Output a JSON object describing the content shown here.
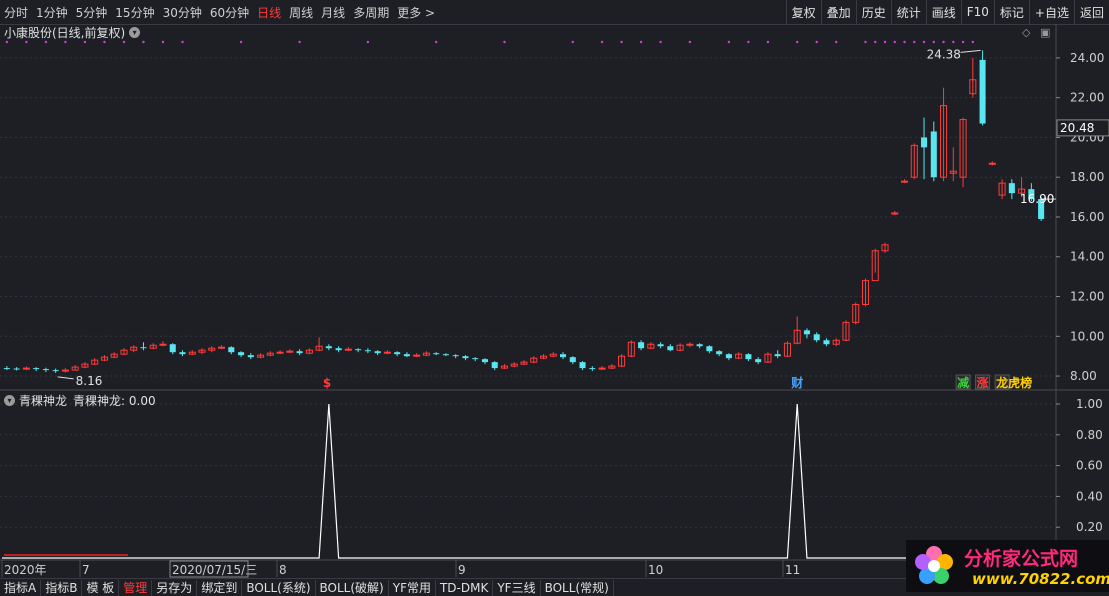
{
  "toolbar": {
    "periods": [
      "分时",
      "1分钟",
      "5分钟",
      "15分钟",
      "30分钟",
      "60分钟",
      "日线",
      "周线",
      "月线",
      "多周期",
      "更多 >"
    ],
    "active_period": "日线",
    "actions": [
      "复权",
      "叠加",
      "历史",
      "统计",
      "画线",
      "F10",
      "标记",
      "+自选",
      "返回"
    ]
  },
  "chart": {
    "title": "小康股份(日线,前复权)",
    "price_axis": [
      "24.00",
      "22.00",
      "20.00",
      "18.00",
      "16.00",
      "14.00",
      "12.00",
      "10.00",
      "8.00"
    ],
    "current_price_box": "20.48",
    "last_price_box": "16.90",
    "max_annotation": "24.38",
    "min_annotation": "8.16",
    "event_markers": [
      {
        "label": "$",
        "color": "#ff3b3b"
      },
      {
        "label": "财",
        "color": "#4aa3ff"
      },
      {
        "label": "减",
        "color": "#3ecf3e"
      },
      {
        "label": "涨",
        "color": "#ff3b3b"
      },
      {
        "label": "龙虎榜",
        "color": "#ffd000"
      }
    ]
  },
  "chart_data": {
    "type": "candlestick",
    "title": "小康股份(日线,前复权)",
    "ylim": [
      7.5,
      24.9
    ],
    "candles": [
      [
        8.4,
        8.38,
        8.5,
        8.3
      ],
      [
        8.38,
        8.36,
        8.45,
        8.28
      ],
      [
        8.36,
        8.4,
        8.48,
        8.3
      ],
      [
        8.4,
        8.35,
        8.45,
        8.25
      ],
      [
        8.35,
        8.3,
        8.42,
        8.2
      ],
      [
        8.3,
        8.25,
        8.38,
        8.16
      ],
      [
        8.25,
        8.3,
        8.4,
        8.18
      ],
      [
        8.3,
        8.45,
        8.55,
        8.28
      ],
      [
        8.45,
        8.6,
        8.7,
        8.4
      ],
      [
        8.6,
        8.8,
        8.9,
        8.55
      ],
      [
        8.8,
        8.95,
        9.05,
        8.75
      ],
      [
        8.95,
        9.1,
        9.2,
        8.9
      ],
      [
        9.1,
        9.3,
        9.4,
        9.05
      ],
      [
        9.3,
        9.45,
        9.55,
        9.2
      ],
      [
        9.45,
        9.4,
        9.7,
        9.3
      ],
      [
        9.4,
        9.55,
        9.65,
        9.35
      ],
      [
        9.55,
        9.6,
        9.75,
        9.5
      ],
      [
        9.6,
        9.2,
        9.65,
        9.1
      ],
      [
        9.2,
        9.1,
        9.3,
        9.0
      ],
      [
        9.1,
        9.2,
        9.3,
        9.05
      ],
      [
        9.2,
        9.3,
        9.4,
        9.1
      ],
      [
        9.3,
        9.4,
        9.5,
        9.2
      ],
      [
        9.4,
        9.45,
        9.55,
        9.35
      ],
      [
        9.45,
        9.2,
        9.5,
        9.1
      ],
      [
        9.2,
        9.05,
        9.25,
        8.95
      ],
      [
        9.05,
        8.95,
        9.15,
        8.85
      ],
      [
        8.95,
        9.05,
        9.15,
        8.9
      ],
      [
        9.05,
        9.15,
        9.25,
        9.0
      ],
      [
        9.15,
        9.2,
        9.3,
        9.1
      ],
      [
        9.2,
        9.25,
        9.35,
        9.15
      ],
      [
        9.25,
        9.15,
        9.35,
        9.05
      ],
      [
        9.15,
        9.3,
        9.4,
        9.1
      ],
      [
        9.3,
        9.5,
        9.95,
        9.25
      ],
      [
        9.5,
        9.4,
        9.6,
        9.3
      ],
      [
        9.4,
        9.3,
        9.5,
        9.2
      ],
      [
        9.3,
        9.35,
        9.45,
        9.25
      ],
      [
        9.35,
        9.3,
        9.4,
        9.2
      ],
      [
        9.3,
        9.25,
        9.4,
        9.15
      ],
      [
        9.25,
        9.15,
        9.3,
        9.05
      ],
      [
        9.15,
        9.2,
        9.3,
        9.1
      ],
      [
        9.2,
        9.1,
        9.25,
        9.0
      ],
      [
        9.1,
        9.0,
        9.2,
        8.95
      ],
      [
        9.0,
        9.05,
        9.15,
        8.95
      ],
      [
        9.05,
        9.15,
        9.25,
        9.0
      ],
      [
        9.15,
        9.1,
        9.2,
        9.05
      ],
      [
        9.1,
        9.05,
        9.15,
        9.0
      ],
      [
        9.05,
        9.0,
        9.1,
        8.9
      ],
      [
        9.0,
        8.9,
        9.05,
        8.8
      ],
      [
        8.9,
        8.85,
        8.95,
        8.75
      ],
      [
        8.85,
        8.7,
        8.9,
        8.6
      ],
      [
        8.7,
        8.4,
        8.75,
        8.3
      ],
      [
        8.4,
        8.5,
        8.6,
        8.35
      ],
      [
        8.5,
        8.6,
        8.7,
        8.45
      ],
      [
        8.6,
        8.7,
        8.8,
        8.55
      ],
      [
        8.7,
        8.9,
        9.0,
        8.65
      ],
      [
        8.9,
        9.0,
        9.1,
        8.85
      ],
      [
        9.0,
        9.1,
        9.2,
        8.95
      ],
      [
        9.1,
        8.95,
        9.2,
        8.85
      ],
      [
        8.95,
        8.7,
        9.0,
        8.6
      ],
      [
        8.7,
        8.4,
        8.75,
        8.3
      ],
      [
        8.4,
        8.35,
        8.5,
        8.25
      ],
      [
        8.35,
        8.4,
        8.5,
        8.3
      ],
      [
        8.4,
        8.5,
        8.6,
        8.35
      ],
      [
        8.5,
        9.0,
        9.1,
        8.45
      ],
      [
        9.0,
        9.7,
        9.8,
        8.95
      ],
      [
        9.7,
        9.4,
        9.8,
        9.3
      ],
      [
        9.4,
        9.6,
        9.7,
        9.35
      ],
      [
        9.6,
        9.5,
        9.7,
        9.4
      ],
      [
        9.5,
        9.3,
        9.6,
        9.25
      ],
      [
        9.3,
        9.55,
        9.65,
        9.25
      ],
      [
        9.55,
        9.6,
        9.7,
        9.45
      ],
      [
        9.6,
        9.5,
        9.65,
        9.4
      ],
      [
        9.5,
        9.25,
        9.55,
        9.15
      ],
      [
        9.25,
        9.1,
        9.3,
        9.0
      ],
      [
        9.1,
        8.9,
        9.15,
        8.8
      ],
      [
        8.9,
        9.1,
        9.2,
        8.85
      ],
      [
        9.1,
        8.85,
        9.15,
        8.75
      ],
      [
        8.85,
        8.7,
        8.95,
        8.6
      ],
      [
        8.7,
        9.1,
        9.2,
        8.65
      ],
      [
        9.1,
        9.0,
        9.3,
        8.9
      ],
      [
        9.0,
        9.65,
        9.75,
        8.95
      ],
      [
        9.65,
        10.3,
        11.0,
        9.6
      ],
      [
        10.3,
        10.1,
        10.4,
        9.9
      ],
      [
        10.1,
        9.8,
        10.2,
        9.7
      ],
      [
        9.8,
        9.6,
        9.9,
        9.5
      ],
      [
        9.6,
        9.8,
        9.9,
        9.5
      ],
      [
        9.8,
        10.7,
        10.8,
        9.75
      ],
      [
        10.7,
        11.6,
        11.7,
        10.6
      ],
      [
        11.6,
        12.8,
        12.9,
        11.5
      ],
      [
        12.8,
        14.3,
        14.4,
        13.2
      ],
      [
        14.3,
        14.6,
        14.7,
        14.2
      ],
      [
        16.2,
        16.2,
        16.3,
        16.1
      ],
      [
        17.8,
        17.8,
        17.9,
        17.7
      ],
      [
        18.0,
        19.6,
        19.7,
        17.9
      ],
      [
        20.0,
        19.5,
        21.0,
        17.9
      ],
      [
        20.3,
        18.0,
        20.8,
        17.8
      ],
      [
        18.0,
        21.6,
        22.5,
        17.8
      ],
      [
        18.2,
        18.3,
        19.5,
        17.8
      ],
      [
        18.0,
        20.9,
        21.0,
        17.5
      ],
      [
        22.2,
        22.9,
        24.0,
        22.0
      ],
      [
        23.9,
        20.7,
        24.38,
        20.6
      ],
      [
        18.7,
        18.7,
        18.8,
        18.6
      ],
      [
        17.1,
        17.7,
        17.9,
        16.9
      ],
      [
        17.7,
        17.2,
        17.9,
        16.9
      ],
      [
        17.2,
        17.4,
        18.0,
        17.0
      ],
      [
        17.4,
        16.9,
        17.7,
        16.8
      ],
      [
        16.9,
        15.9,
        17.0,
        15.8
      ]
    ],
    "indicator": {
      "name": "青稞神龙",
      "value_label": "青稞神龙: 0.00",
      "ylim": [
        0,
        1.0
      ],
      "ticks": [
        "1.00",
        "0.80",
        "0.60",
        "0.40",
        "0.20"
      ],
      "spike_candle_indices": [
        33,
        81
      ]
    },
    "date_axis": [
      "2020年",
      "7",
      "2020/07/15/三",
      "8",
      "9",
      "10",
      "11"
    ]
  },
  "indicator_title": "青稞神龙",
  "indicator_value": "青稞神龙: 0.00",
  "bottombar": [
    "指标A",
    "指标B",
    "模 板",
    "管理",
    "另存为",
    "绑定到",
    "BOLL(系统)",
    "BOLL(破解)",
    "YF常用",
    "TD-DMK",
    "YF三线",
    "BOLL(常规)"
  ],
  "bottombar_highlight": "管理",
  "logo": {
    "line1": "分析家公式网",
    "line2": "www.70822.com"
  },
  "colors": {
    "up": "#ff3b3b",
    "down": "#5ae6f0",
    "bg": "#1e1f24",
    "grid": "#33343b",
    "purple_dot": "#d040e0"
  }
}
